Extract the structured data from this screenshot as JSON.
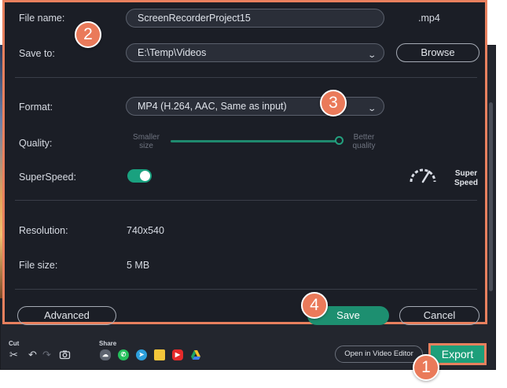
{
  "dialog": {
    "file_name_label": "File name:",
    "file_name_value": "ScreenRecorderProject15",
    "file_extension": ".mp4",
    "save_to_label": "Save to:",
    "save_to_value": "E:\\Temp\\Videos",
    "browse_label": "Browse",
    "format_label": "Format:",
    "format_value": "MP4 (H.264, AAC, Same as input)",
    "quality_label": "Quality:",
    "quality_min_line1": "Smaller",
    "quality_min_line2": "size",
    "quality_max_line1": "Better",
    "quality_max_line2": "quality",
    "quality_level": 1.0,
    "superspeed_label": "SuperSpeed:",
    "superspeed_enabled": true,
    "superspeed_badge_line1": "Super",
    "superspeed_badge_line2": "Speed",
    "resolution_label": "Resolution:",
    "resolution_value": "740x540",
    "file_size_label": "File size:",
    "file_size_value": "5 MB",
    "advanced_label": "Advanced",
    "save_label": "Save",
    "cancel_label": "Cancel"
  },
  "callouts": [
    "1",
    "2",
    "3",
    "4"
  ],
  "toolbar": {
    "cut_label": "Cut",
    "share_label": "Share",
    "open_editor_label": "Open in Video Editor",
    "export_label": "Export",
    "tool_icons": [
      "scissors-icon",
      "undo-icon",
      "redo-icon",
      "camera-icon"
    ],
    "share_icons": [
      "cloud-upload-icon",
      "whatsapp-icon",
      "telegram-icon",
      "google-drive-folder-icon",
      "youtube-icon",
      "google-drive-icon"
    ]
  },
  "colors": {
    "accent_green": "#1d9f7a",
    "highlight_orange": "#e8805e",
    "dialog_bg": "#1b1e26"
  }
}
